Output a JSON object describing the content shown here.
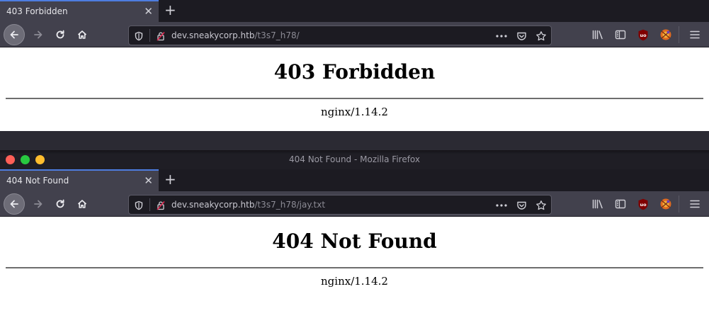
{
  "windows": [
    {
      "title": "",
      "tab": {
        "title": "403 Forbidden"
      },
      "url": {
        "host": "dev.sneakycorp.htb",
        "path": "/t3s7_h78/"
      },
      "page": {
        "heading": "403 Forbidden",
        "server": "nginx/1.14.2"
      }
    },
    {
      "title": "404 Not Found - Mozilla Firefox",
      "tab": {
        "title": "404 Not Found"
      },
      "url": {
        "host": "dev.sneakycorp.htb",
        "path": "/t3s7_h78/jay.txt"
      },
      "page": {
        "heading": "404 Not Found",
        "server": "nginx/1.14.2"
      }
    }
  ],
  "icons": {
    "nav": [
      "back-icon",
      "forward-icon",
      "reload-icon",
      "home-icon"
    ],
    "urlbar": [
      "shield-icon",
      "insecure-lock-icon",
      "page-actions-icon",
      "pocket-icon",
      "bookmark-star-icon"
    ],
    "toolbar": [
      "library-icon",
      "sidebar-icon",
      "ublock-icon",
      "extension-icon",
      "menu-icon"
    ]
  },
  "colors": {
    "accent": "#4d7de0",
    "chrome": "#42414d",
    "tabstrip": "#1c1b22",
    "ublock": "#800000"
  }
}
